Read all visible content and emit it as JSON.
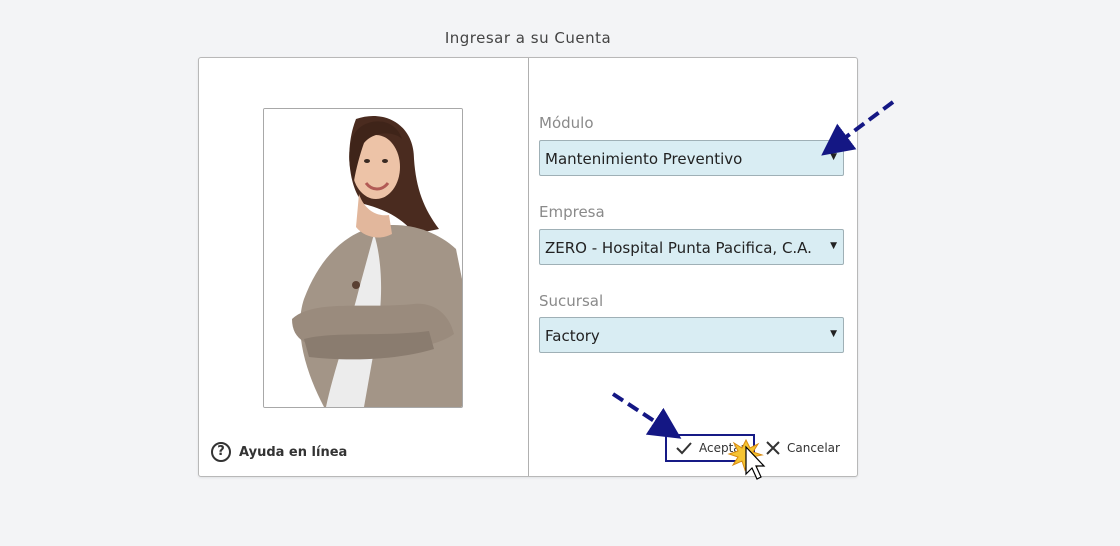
{
  "dialog": {
    "title": "Ingresar a su Cuenta"
  },
  "left": {
    "help_label": "Ayuda en línea",
    "help_icon": "question-circle-icon"
  },
  "fields": {
    "modulo": {
      "label": "Módulo",
      "value": "Mantenimiento Preventivo"
    },
    "empresa": {
      "label": "Empresa",
      "value": "ZERO - Hospital Punta Pacifica, C.A."
    },
    "sucursal": {
      "label": "Sucursal",
      "value": "Factory"
    }
  },
  "actions": {
    "accept_label": "Aceptar",
    "cancel_label": "Cancelar"
  },
  "colors": {
    "select_bg": "#d9edf3",
    "annotation_arrow": "#141784",
    "accept_border": "#161a86"
  }
}
